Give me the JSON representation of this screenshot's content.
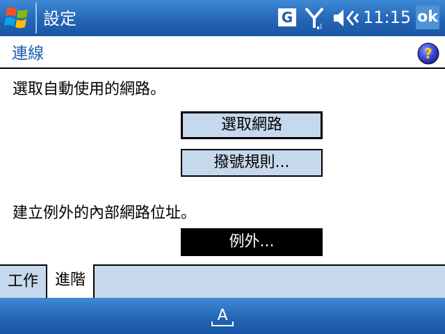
{
  "titlebar": {
    "title": "設定",
    "g_label": "G",
    "clock": "11:15",
    "ok_label": "ok",
    "icons": [
      "windows-start-icon",
      "signal-icon",
      "volume-icon"
    ]
  },
  "header": {
    "title": "連線",
    "help_icon": "help-icon"
  },
  "body": {
    "networks_desc": "選取自動使用的網路。",
    "select_networks_button": "選取網路",
    "dialing_rules_button": "撥號規則...",
    "exceptions_desc": "建立例外的內部網路位址。",
    "exceptions_button": "例外..."
  },
  "tabs": [
    {
      "label": "工作",
      "active": false
    },
    {
      "label": "進階",
      "active": true
    }
  ],
  "softbar": {
    "input_icon": "input-panel-icon"
  },
  "colors": {
    "titlebar_blue": "#2465b6",
    "header_text": "#1a5fb0",
    "button_fill": "#c6d8ec",
    "tab_fill": "#c6d8ec"
  }
}
